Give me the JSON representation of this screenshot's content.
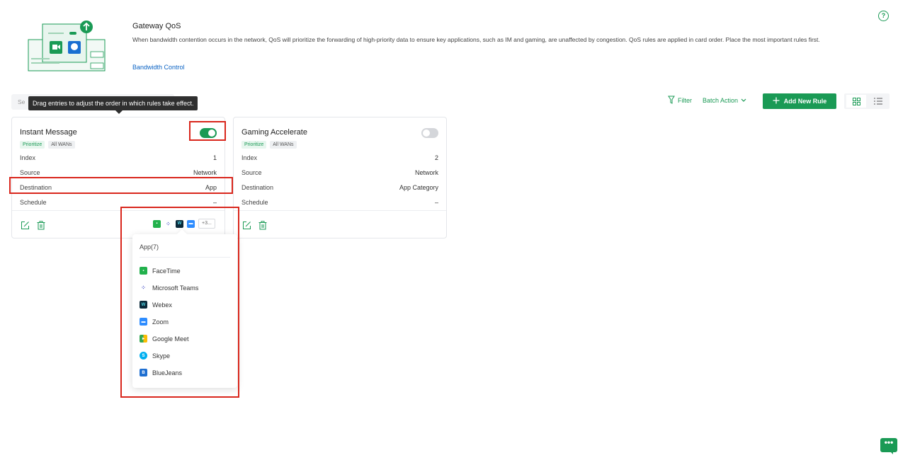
{
  "header": {
    "title": "Gateway QoS",
    "description": "When bandwidth contention occurs in the network, QoS will prioritize the forwarding of high-priority data to ensure key applications, such as IM and gaming, are unaffected by congestion. QoS rules are applied in card order. Place the most important rules first.",
    "link": "Bandwidth Control",
    "help_icon": "?"
  },
  "toolbar": {
    "search_placeholder": "Se",
    "tooltip": "Drag entries to adjust the order in which rules take effect.",
    "filter_label": "Filter",
    "batch_action_label": "Batch Action",
    "add_rule_label": "Add New Rule"
  },
  "cards": [
    {
      "name": "Instant Message",
      "tags": [
        "Prioritize",
        "All WANs"
      ],
      "enabled": true,
      "fields": [
        {
          "label": "Index",
          "value": "1"
        },
        {
          "label": "Source",
          "value": "Network"
        },
        {
          "label": "Destination",
          "value": "App"
        },
        {
          "label": "Schedule",
          "value": "–"
        }
      ],
      "more_apps": "+3..."
    },
    {
      "name": "Gaming Accelerate",
      "tags": [
        "Prioritize",
        "All WANs"
      ],
      "enabled": false,
      "fields": [
        {
          "label": "Index",
          "value": "2"
        },
        {
          "label": "Source",
          "value": "Network"
        },
        {
          "label": "Destination",
          "value": "App Category"
        },
        {
          "label": "Schedule",
          "value": "–"
        }
      ]
    }
  ],
  "popover": {
    "title": "App(7)",
    "items": [
      "FaceTime",
      "Microsoft Teams",
      "Webex",
      "Zoom",
      "Google Meet",
      "Skype",
      "BlueJeans"
    ]
  },
  "colors": {
    "accent": "#1a9a55",
    "link": "#0b63c4",
    "highlight": "#d9261c"
  }
}
